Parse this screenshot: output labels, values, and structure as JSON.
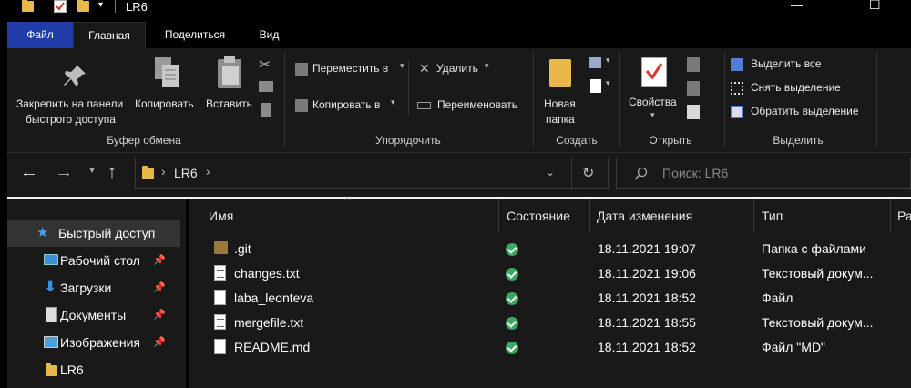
{
  "window": {
    "title": "LR6",
    "minimize_glyph": "—",
    "maximize_glyph": "☐"
  },
  "ribbon_tabs": [
    "Файл",
    "Главная",
    "Поделиться",
    "Вид"
  ],
  "ribbon": {
    "clipboard": {
      "pin_label_1": "Закрепить на панели",
      "pin_label_2": "быстрого доступа",
      "copy": "Копировать",
      "paste": "Вставить",
      "group": "Буфер обмена"
    },
    "organize": {
      "move_to": "Переместить в",
      "copy_to": "Копировать в",
      "delete": "Удалить",
      "rename": "Переименовать",
      "group": "Упорядочить"
    },
    "new": {
      "new_folder_1": "Новая",
      "new_folder_2": "папка",
      "group": "Создать"
    },
    "open": {
      "properties": "Свойства",
      "group": "Открыть"
    },
    "select": {
      "select_all": "Выделить все",
      "select_none": "Снять выделение",
      "invert": "Обратить выделение",
      "group": "Выделить"
    }
  },
  "address": {
    "crumb": "LR6",
    "search_placeholder": "Поиск: LR6"
  },
  "nav": {
    "items": [
      {
        "label": "Быстрый доступ",
        "icon": "star-icon",
        "pinned": false
      },
      {
        "label": "Рабочий стол",
        "icon": "desktop-icon",
        "pinned": true
      },
      {
        "label": "Загрузки",
        "icon": "download-icon",
        "pinned": true
      },
      {
        "label": "Документы",
        "icon": "documents-icon",
        "pinned": true
      },
      {
        "label": "Изображения",
        "icon": "pictures-icon",
        "pinned": true
      },
      {
        "label": "LR6",
        "icon": "folder-icon",
        "pinned": false
      }
    ]
  },
  "columns": [
    "Имя",
    "Состояние",
    "Дата изменения",
    "Тип",
    "Ра"
  ],
  "files": [
    {
      "name": ".git",
      "date": "18.11.2021 19:07",
      "type": "Папка с файлами",
      "icon": "folder-icon"
    },
    {
      "name": "changes.txt",
      "date": "18.11.2021 19:06",
      "type": "Текстовый докум...",
      "icon": "text-file-icon"
    },
    {
      "name": "laba_leonteva",
      "date": "18.11.2021 18:52",
      "type": "Файл",
      "icon": "file-icon"
    },
    {
      "name": "mergefile.txt",
      "date": "18.11.2021 18:55",
      "type": "Текстовый докум...",
      "icon": "text-file-icon"
    },
    {
      "name": "README.md",
      "date": "18.11.2021 18:52",
      "type": "Файл \"MD\"",
      "icon": "file-icon"
    }
  ],
  "colors": {
    "accent_file_tab": "#1f3ca8",
    "folder": "#e8b84a",
    "status_ok": "#3aa861",
    "background": "#191919"
  }
}
